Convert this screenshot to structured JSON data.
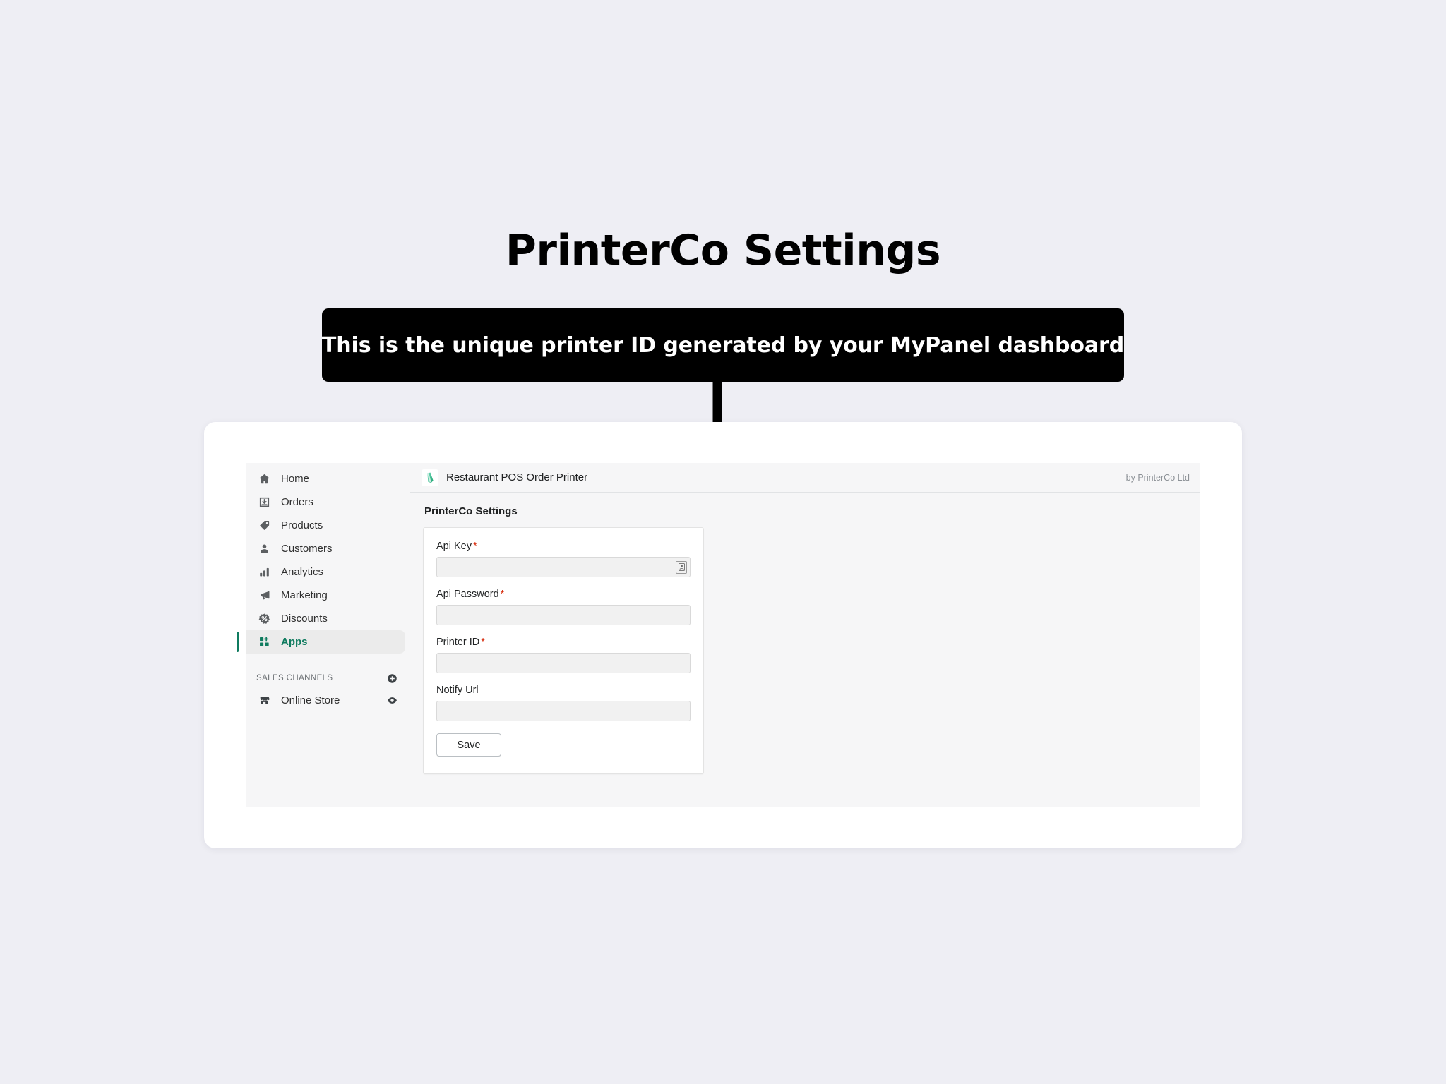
{
  "annotation": {
    "title": "PrinterCo Settings",
    "callout_text": "This is the unique printer ID generated by your MyPanel dashboard",
    "callout_bg": "#000000",
    "callout_fg": "#ffffff",
    "arrow_color": "#000000",
    "arrow_target": "printer-id-input"
  },
  "colors": {
    "page_background": "#eeeef4",
    "accent_green": "#0f7b5f",
    "required_red": "#d72c0d",
    "panel_gray": "#f6f6f7",
    "input_gray": "#f1f1f1"
  },
  "sidebar": {
    "items": [
      {
        "label": "Home",
        "icon": "home-icon",
        "active": false
      },
      {
        "label": "Orders",
        "icon": "orders-icon",
        "active": false
      },
      {
        "label": "Products",
        "icon": "products-tag-icon",
        "active": false
      },
      {
        "label": "Customers",
        "icon": "customers-person-icon",
        "active": false
      },
      {
        "label": "Analytics",
        "icon": "analytics-bars-icon",
        "active": false
      },
      {
        "label": "Marketing",
        "icon": "marketing-megaphone-icon",
        "active": false
      },
      {
        "label": "Discounts",
        "icon": "discounts-percent-icon",
        "active": false
      },
      {
        "label": "Apps",
        "icon": "apps-grid-plus-icon",
        "active": true
      }
    ],
    "channels": {
      "title": "SALES CHANNELS",
      "add_icon": "plus-circle-icon",
      "items": [
        {
          "label": "Online Store",
          "icon": "store-icon",
          "action_icon": "eye-icon"
        }
      ]
    }
  },
  "app_header": {
    "app_icon": "printer-app-icon",
    "app_name": "Restaurant POS Order Printer",
    "byline": "by PrinterCo Ltd"
  },
  "form": {
    "heading": "PrinterCo Settings",
    "fields": [
      {
        "label": "Api Key",
        "required": true,
        "value": "",
        "placeholder": "",
        "has_autofill_badge": true,
        "badge_icon": "contact-card-icon"
      },
      {
        "label": "Api Password",
        "required": true,
        "value": "",
        "placeholder": "",
        "has_autofill_badge": false
      },
      {
        "label": "Printer ID",
        "required": true,
        "value": "",
        "placeholder": "",
        "has_autofill_badge": false
      },
      {
        "label": "Notify Url",
        "required": false,
        "value": "",
        "placeholder": "",
        "has_autofill_badge": false
      }
    ],
    "required_marker": "*",
    "save_label": "Save"
  }
}
